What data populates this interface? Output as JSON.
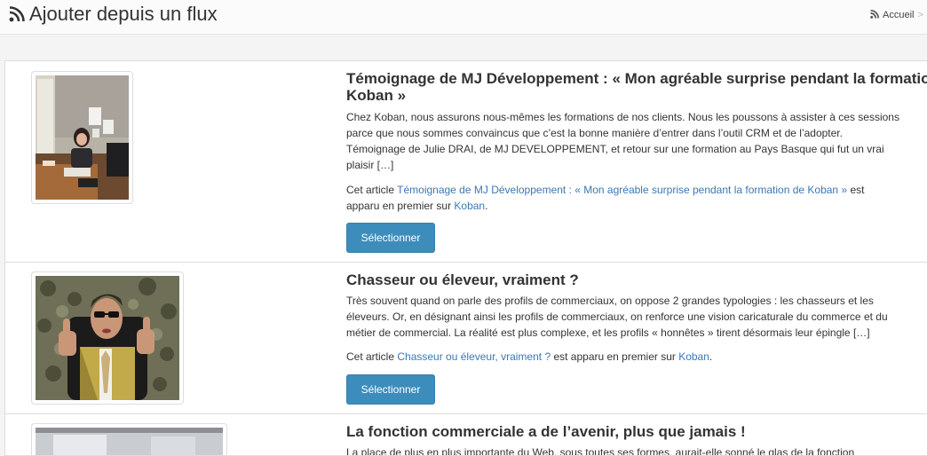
{
  "header": {
    "title": "Ajouter depuis un flux",
    "breadcrumb": {
      "home_label": "Accueil",
      "separator": ">"
    }
  },
  "colors": {
    "accent": "#3c8dbc",
    "link": "#3c78b4"
  },
  "items": [
    {
      "title_lines": [
        "Témoignage de MJ Développement : « Mon agréable surprise pendant la formation de",
        "Koban »"
      ],
      "desc_lines": [
        "Chez Koban, nous assurons nous-mêmes les formations de nos clients. Nous les poussons à assister à ces sessions",
        "parce que nous sommes convaincus que c’est la bonne manière d’entrer dans l’outil CRM et de l’adopter.",
        "Témoignage de Julie DRAI, de MJ DEVELOPPEMENT, et retour sur une formation au Pays Basque qui fut un vrai",
        "plaisir […]"
      ],
      "attr_prefix": "Cet article ",
      "attr_link": "Témoignage de MJ Développement : « Mon agréable surprise pendant la formation de Koban »",
      "attr_mid": " est",
      "attr_mid2": "apparu en premier sur ",
      "attr_site": "Koban",
      "attr_end": ".",
      "button_label": "Sélectionner",
      "image": "office-photo"
    },
    {
      "title": "Chasseur ou éleveur, vraiment ?",
      "desc_lines": [
        "Très souvent quand on parle des profils de commerciaux, on oppose 2 grandes typologies : les chasseurs et les",
        "éleveurs. Or, en désignant ainsi les profils de commerciaux, on renforce une vision caricaturale du commerce et du",
        "métier de commercial. La réalité est plus complexe, et les profils « honnêtes » tirent désormais leur épingle […]"
      ],
      "attr_prefix": "Cet article ",
      "attr_link": "Chasseur ou éleveur, vraiment ?",
      "attr_mid": " est apparu en premier sur ",
      "attr_site": "Koban",
      "attr_end": ".",
      "button_label": "Sélectionner",
      "image": "thumbs-up-photo"
    },
    {
      "title": "La fonction commerciale a de l’avenir, plus que jamais !",
      "desc_lines": [
        "La place de plus en plus importante du Web, sous toutes ses formes, aurait-elle sonné le glas de la fonction"
      ],
      "image": "meeting-photo"
    }
  ]
}
